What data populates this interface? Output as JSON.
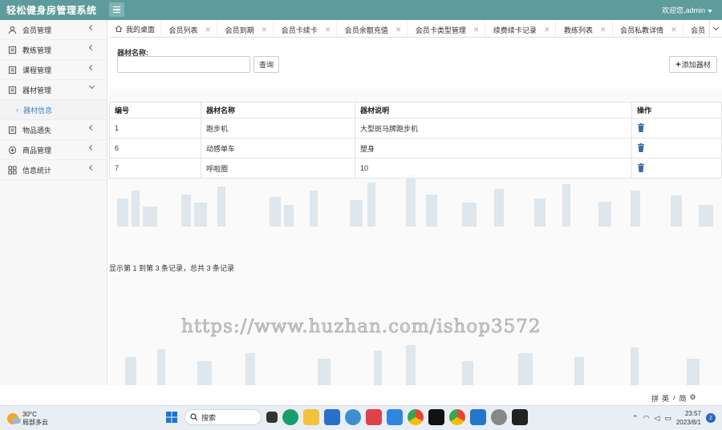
{
  "app": {
    "title": "轻松健身房管理系统",
    "welcome": "欢迎您,admin"
  },
  "sidebar": {
    "items": [
      {
        "label": "会员管理",
        "icon": "user-icon"
      },
      {
        "label": "教练管理",
        "icon": "doc-icon"
      },
      {
        "label": "课程管理",
        "icon": "doc-icon"
      },
      {
        "label": "器材管理",
        "icon": "doc-icon",
        "expanded": true
      },
      {
        "label": "物品遗失",
        "icon": "doc-icon"
      },
      {
        "label": "商品管理",
        "icon": "gift-icon"
      },
      {
        "label": "信息统计",
        "icon": "grid-icon"
      }
    ],
    "sub_item": "器材信息"
  },
  "tabs": [
    "我的桌面",
    "会员列表",
    "会员到期",
    "会员卡续卡",
    "会员余额充值",
    "会员卡类型管理",
    "续费续卡记录",
    "教练列表",
    "会员私教详情",
    "会员"
  ],
  "search": {
    "label": "器材名称:",
    "value": "",
    "placeholder": ""
  },
  "buttons": {
    "query": "查询",
    "add": "添加器材"
  },
  "table": {
    "headers": [
      "编号",
      "器材名称",
      "器材说明",
      "操作"
    ],
    "rows": [
      [
        "1",
        "跑步机",
        "大型斑马牌跑步机"
      ],
      [
        "6",
        "动感单车",
        "塑身"
      ],
      [
        "7",
        "呼啦圈",
        "10"
      ]
    ]
  },
  "pager": "显示第 1 到第 3 条记录，总共 3 条记录",
  "watermark": "https://www.huzhan.com/ishop3572",
  "ime": [
    "拼",
    "英",
    "♪",
    "简",
    "⚙"
  ],
  "taskbar": {
    "weather_temp": "30°C",
    "weather_desc": "局部多云",
    "search_label": "搜索",
    "time": "23:57",
    "date": "2023/8/1",
    "notifications": "2"
  },
  "colors": {
    "topbar": "#5e9b9b",
    "link": "#3a87c8",
    "trash": "#3a6ea5"
  }
}
